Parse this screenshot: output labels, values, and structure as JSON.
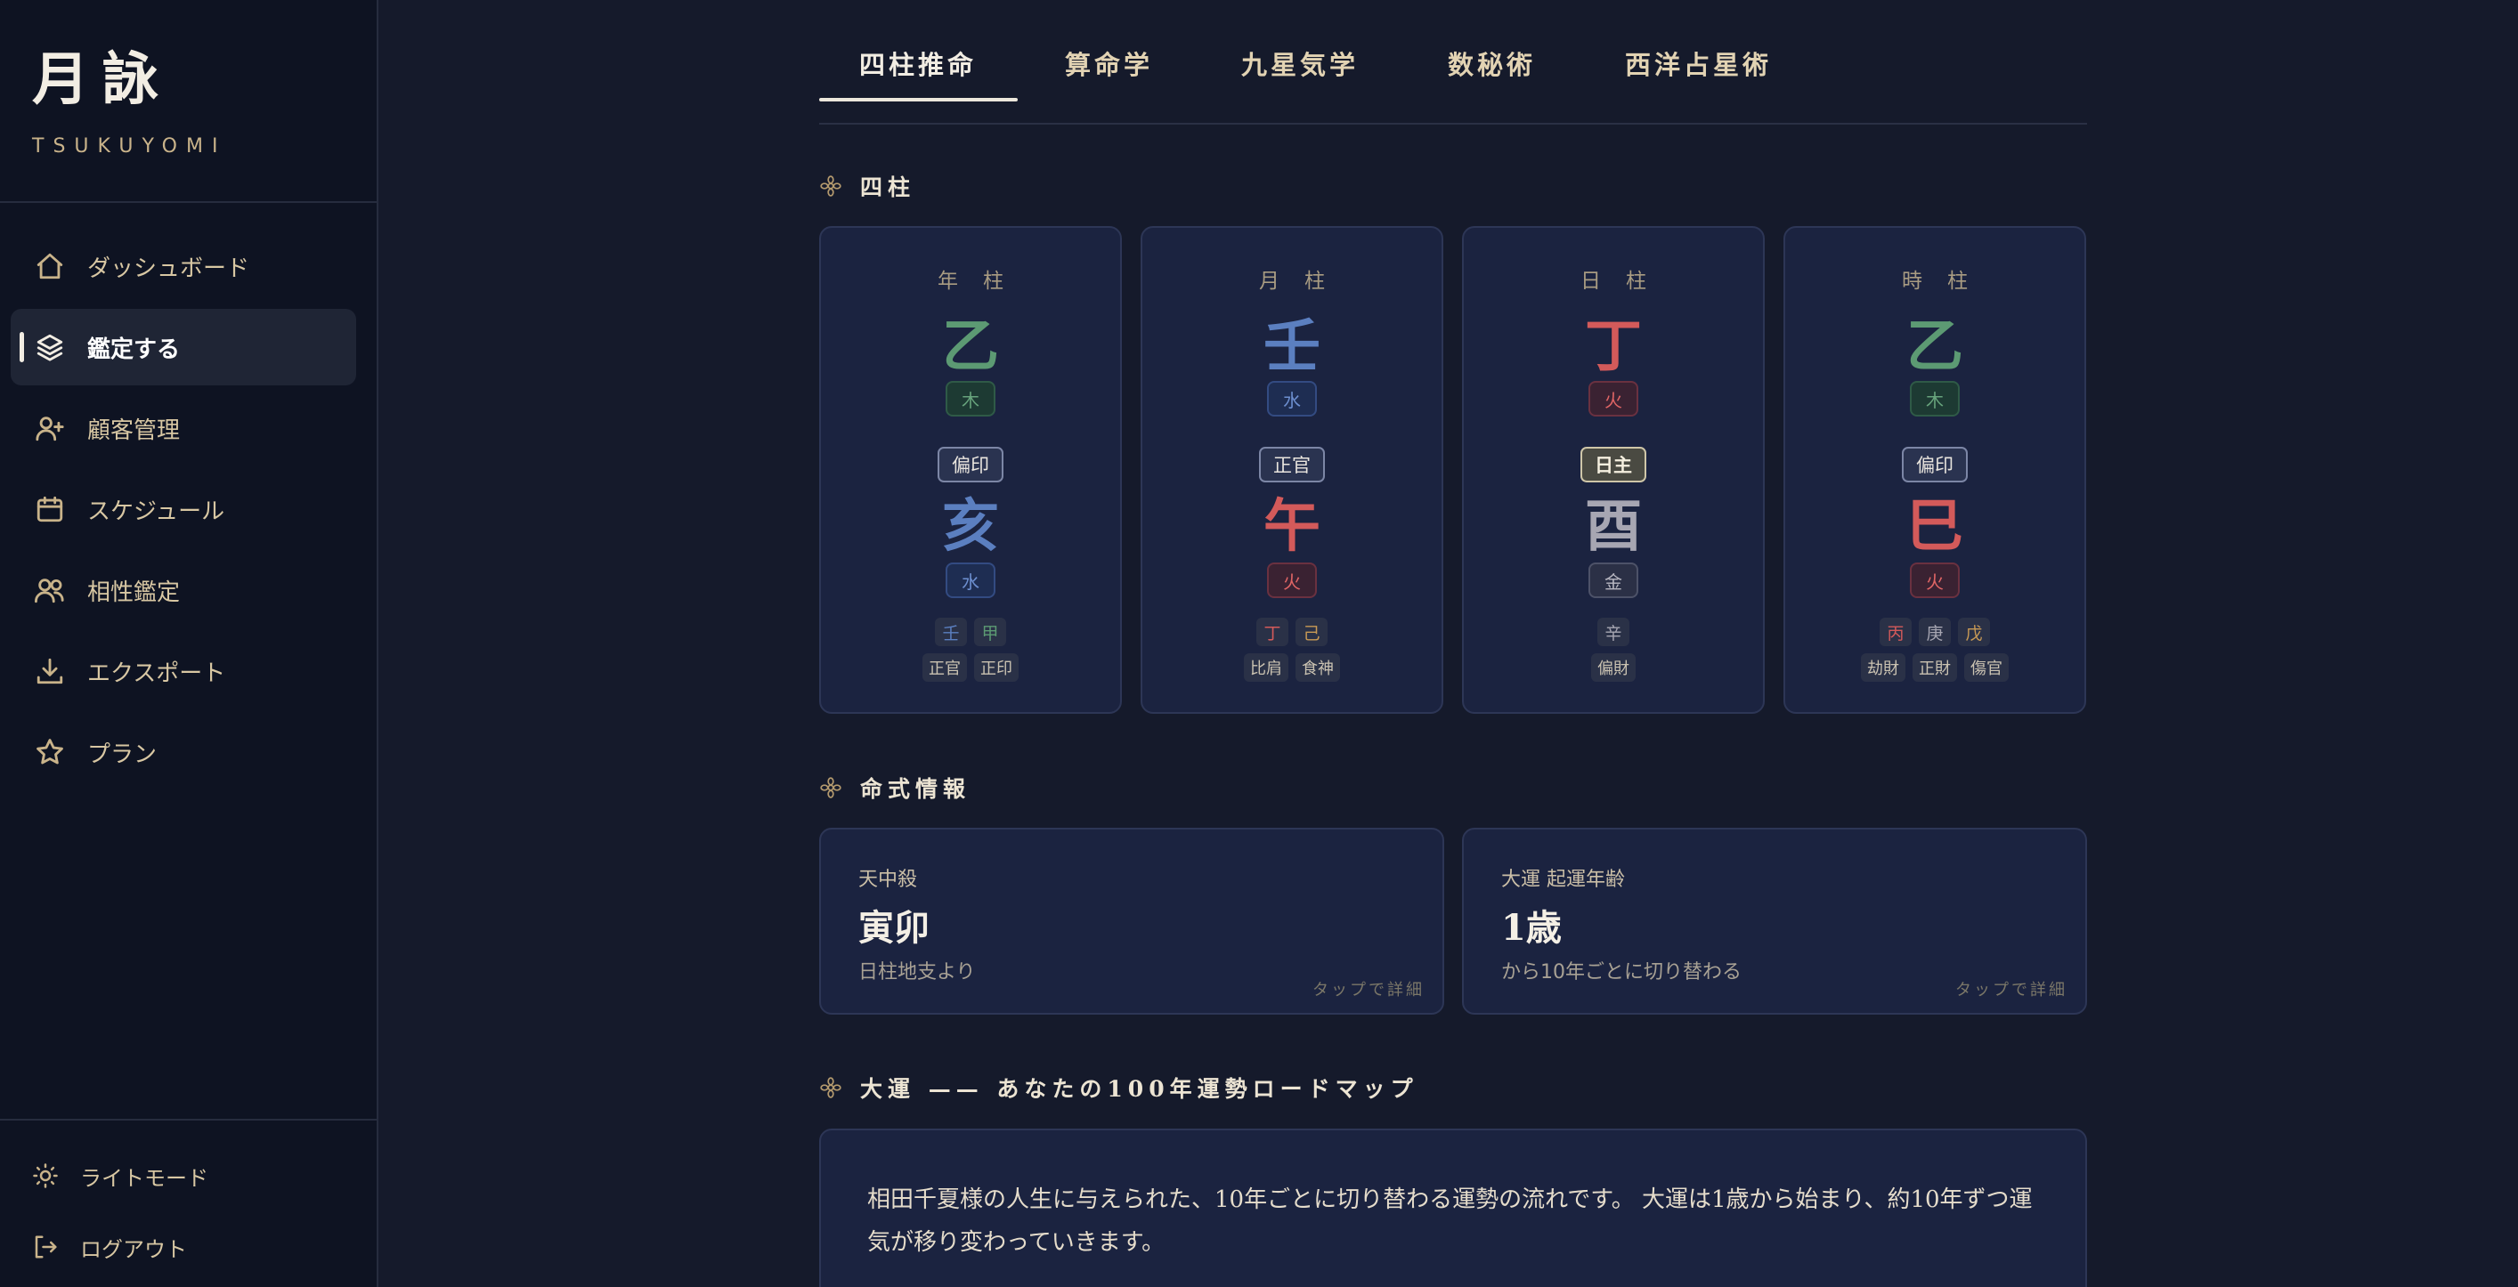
{
  "brand": {
    "title": "月詠",
    "subtitle": "TSUKUYOMI"
  },
  "sidebar": {
    "items": [
      {
        "label": "ダッシュボード",
        "icon": "home-icon"
      },
      {
        "label": "鑑定する",
        "icon": "layers-icon",
        "active": true
      },
      {
        "label": "顧客管理",
        "icon": "user-plus-icon"
      },
      {
        "label": "スケジュール",
        "icon": "calendar-icon"
      },
      {
        "label": "相性鑑定",
        "icon": "users-icon"
      },
      {
        "label": "エクスポート",
        "icon": "download-icon"
      },
      {
        "label": "プラン",
        "icon": "star-icon"
      }
    ],
    "bottom": [
      {
        "label": "ライトモード",
        "icon": "sun-icon"
      },
      {
        "label": "ログアウト",
        "icon": "logout-icon"
      }
    ]
  },
  "tabs": [
    {
      "label": "四柱推命",
      "active": true
    },
    {
      "label": "算命学"
    },
    {
      "label": "九星気学"
    },
    {
      "label": "数秘術"
    },
    {
      "label": "西洋占星術"
    }
  ],
  "sections": {
    "pillars": "四柱",
    "info": "命式情報",
    "daiun": "大運 —— あなたの100年運勢ロードマップ"
  },
  "pillars": [
    {
      "label": "年柱",
      "stem": "乙",
      "stem_element": "木",
      "tengod": "偏印",
      "branch": "亥",
      "branch_element": "水",
      "hidden_stems": [
        "壬",
        "甲"
      ],
      "hidden_gods": [
        "正官",
        "正印"
      ]
    },
    {
      "label": "月柱",
      "stem": "壬",
      "stem_element": "水",
      "tengod": "正官",
      "branch": "午",
      "branch_element": "火",
      "hidden_stems": [
        "丁",
        "己"
      ],
      "hidden_gods": [
        "比肩",
        "食神"
      ]
    },
    {
      "label": "日柱",
      "stem": "丁",
      "stem_element": "火",
      "tengod": "日主",
      "branch": "酉",
      "branch_element": "金",
      "hidden_stems": [
        "辛"
      ],
      "hidden_gods": [
        "偏財"
      ]
    },
    {
      "label": "時柱",
      "stem": "乙",
      "stem_element": "木",
      "tengod": "偏印",
      "branch": "巳",
      "branch_element": "火",
      "hidden_stems": [
        "丙",
        "庚",
        "戊"
      ],
      "hidden_gods": [
        "劫財",
        "正財",
        "傷官"
      ]
    }
  ],
  "info_cards": [
    {
      "label": "天中殺",
      "value": "寅卯",
      "sub": "日柱地支より",
      "hint": "タップで詳細"
    },
    {
      "label": "大運 起運年齢",
      "value": "1歳",
      "sub": "から10年ごとに切り替わる",
      "hint": "タップで詳細"
    }
  ],
  "daiun": {
    "intro": "相田千夏様の人生に与えられた、10年ごとに切り替わる運勢の流れです。 大運は1歳から始まり、約10年ずつ運気が移り変わっていきます。"
  },
  "colors": {
    "wood": "#5c9a73",
    "water": "#5b7fc0",
    "fire": "#d35a5a",
    "metal": "#a7a6b2",
    "earth": "#c99a55",
    "accent_gold": "#c9b38a"
  }
}
